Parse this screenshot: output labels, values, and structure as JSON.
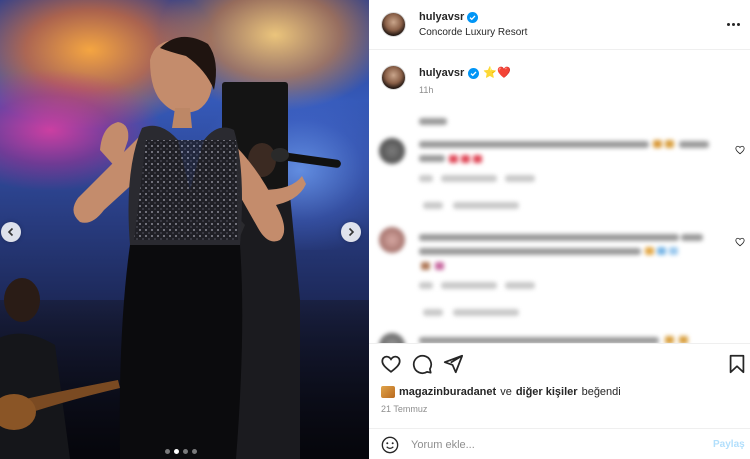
{
  "post": {
    "username": "hulyavsr",
    "location": "Concorde Luxury Resort",
    "more_icon": "more-horizontal-icon",
    "verified_color": "#0095f6"
  },
  "caption": {
    "username": "hulyavsr",
    "emojis": "⭐❤️",
    "time": "11h"
  },
  "carousel": {
    "prev_icon": "chevron-left-icon",
    "next_icon": "chevron-right-icon",
    "slide_count": 4,
    "active_slide": 2
  },
  "actions": {
    "like_icon": "heart-icon",
    "comment_icon": "comment-icon",
    "share_icon": "send-icon",
    "save_icon": "bookmark-icon"
  },
  "likes": {
    "first_user": "magazinburadanet",
    "connector": "ve",
    "others": "diğer kişiler",
    "suffix": "beğendi"
  },
  "date": "21 Temmuz",
  "comment_box": {
    "placeholder": "Yorum ekle...",
    "post_label": "Paylaş",
    "post_color": "#b2dffc"
  }
}
